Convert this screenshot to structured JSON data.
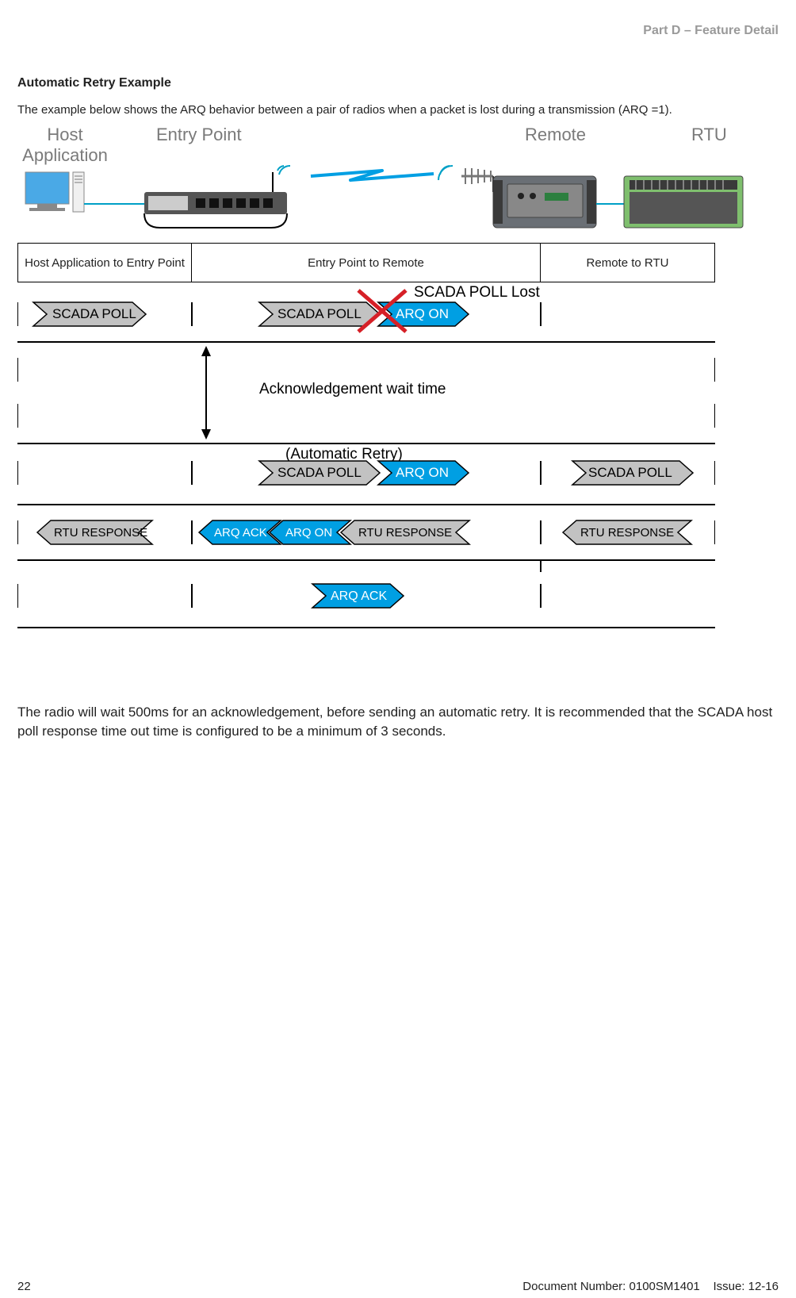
{
  "header": {
    "part": "Part D – Feature Detail"
  },
  "section": {
    "title": "Automatic Retry Example",
    "intro": "The example below shows the ARQ behavior between a pair of radios when a packet is lost during a transmission (ARQ =1)."
  },
  "devices": {
    "host": "Host Application",
    "entry": "Entry Point",
    "remote": "Remote",
    "rtu": "RTU"
  },
  "columns": {
    "c1": "Host Application to Entry Point",
    "c2": "Entry Point to Remote",
    "c3": "Remote to RTU"
  },
  "diagram": {
    "scada_poll": "SCADA POLL",
    "arq_on": "ARQ ON",
    "arq_ack": "ARQ ACK",
    "rtu_response": "RTU RESPONSE",
    "lost_label": "SCADA POLL Lost",
    "wait_label": "Acknowledgement wait time",
    "retry_label": "(Automatic Retry)"
  },
  "closing": "The radio will wait 500ms for an acknowledgement, before sending an automatic retry. It is recommended that the SCADA host poll response time out time is configured to be a minimum of 3 seconds.",
  "footer": {
    "page_no": "22",
    "doc_no": "Document Number: 0100SM1401",
    "issue": "Issue: 12-16"
  }
}
